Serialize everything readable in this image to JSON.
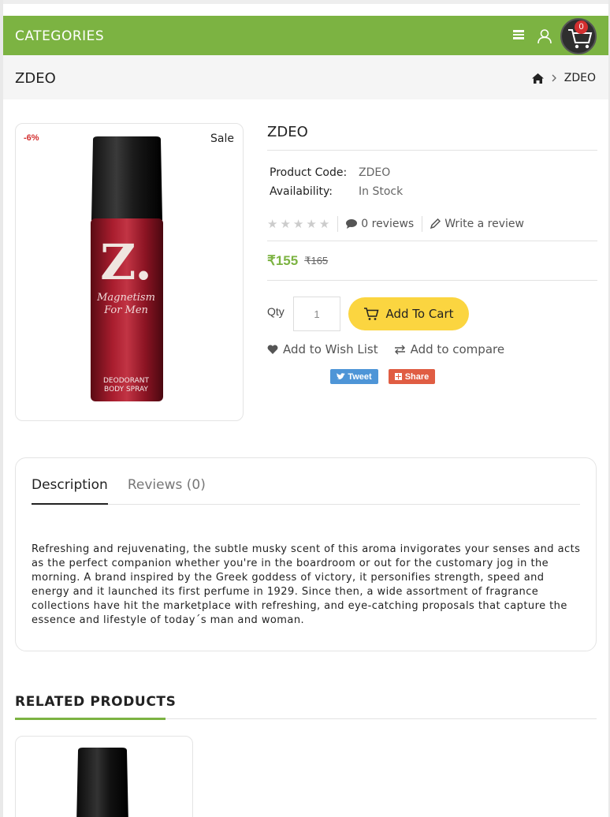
{
  "header": {
    "categories_label": "CATEGORIES",
    "cart_count": "0"
  },
  "breadcrumb": {
    "page_title": "ZDEO",
    "current": "ZDEO"
  },
  "product": {
    "discount_badge": "-6%",
    "sale_badge": "Sale",
    "title": "ZDEO",
    "code_label": "Product Code:",
    "code_value": "ZDEO",
    "availability_label": "Availability:",
    "availability_value": "In Stock",
    "rating": 0,
    "reviews_link": "0 reviews",
    "write_review": "Write a review",
    "price_new": "₹155",
    "price_old": "₹165",
    "qty_label": "Qty",
    "qty_value": "1",
    "add_to_cart": "Add To Cart",
    "wishlist": "Add to Wish List",
    "compare": "Add to compare",
    "tweet": "Tweet",
    "share": "Share",
    "image_text_brand": "Z.",
    "image_text_line1": "Magnetism",
    "image_text_line2": "For Men",
    "image_text_type1": "DEODORANT",
    "image_text_type2": "BODY SPRAY"
  },
  "tabs": {
    "description": "Description",
    "reviews": "Reviews (0)",
    "description_text": "Refreshing and rejuvenating, the subtle musky scent of this aroma invigorates your senses and acts as the perfect companion whether you're in the boardroom or out for the customary jog in the morning. A brand inspired by the Greek goddess of victory, it personifies strength, speed and energy and it launched its first perfume in 1929. Since then, a wide assortment of fragrance collections have hit the marketplace with refreshing, and eye-catching proposals that capture the essence and lifestyle of today´s man and woman."
  },
  "related": {
    "title": "RELATED PRODUCTS"
  },
  "colors": {
    "brand_green": "#7cb342",
    "cart_yellow": "#fbd540",
    "badge_red": "#d32f2f"
  }
}
